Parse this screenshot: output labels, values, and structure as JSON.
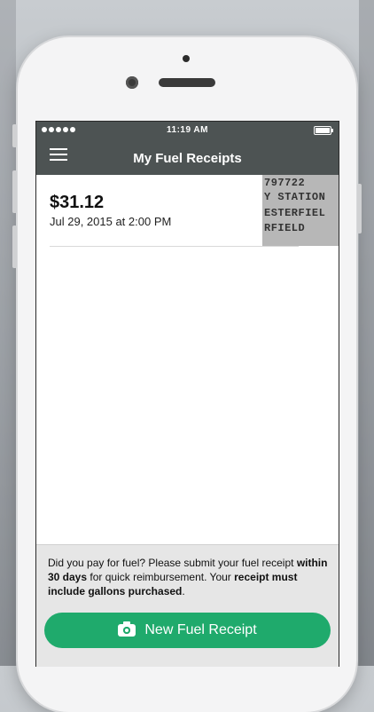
{
  "status_bar": {
    "time": "11:19 AM"
  },
  "nav": {
    "title": "My Fuel Receipts"
  },
  "receipts": [
    {
      "amount": "$31.12",
      "date": "Jul 29, 2015 at 2:00 PM",
      "thumbnail_lines": [
        "797722",
        "Y STATION",
        "ESTERFIEL",
        "RFIELD"
      ]
    }
  ],
  "footer": {
    "notice_part1": "Did you pay for fuel? Please submit your fuel receipt ",
    "notice_bold1": "within 30 days",
    "notice_part2": " for quick reimbursement. Your ",
    "notice_bold2": "receipt must include gallons purchased",
    "notice_part3": ".",
    "button_label": "New Fuel Receipt"
  },
  "colors": {
    "header": "#4d5353",
    "accent": "#1faa6c",
    "footer_bg": "#e6e6e6"
  },
  "icons": [
    "menu-icon",
    "camera-icon",
    "battery-icon"
  ]
}
